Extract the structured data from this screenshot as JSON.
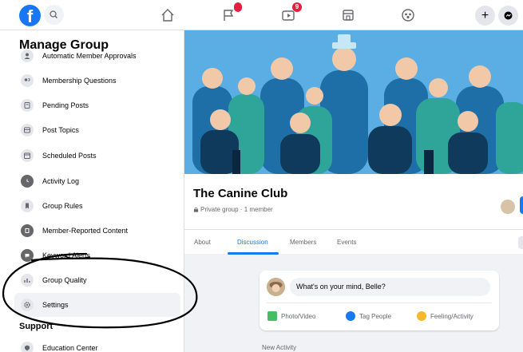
{
  "topbar": {
    "logo": "f",
    "notifications_badge": "",
    "video_badge": "9",
    "plus": "+"
  },
  "sidebar": {
    "title": "Manage Group",
    "items": [
      {
        "label": "Automatic Member Approvals",
        "icon": "member-approvals-icon"
      },
      {
        "label": "Membership Questions",
        "icon": "question-icon"
      },
      {
        "label": "Pending Posts",
        "icon": "pending-posts-icon"
      },
      {
        "label": "Post Topics",
        "icon": "post-topics-icon"
      },
      {
        "label": "Scheduled Posts",
        "icon": "calendar-icon"
      },
      {
        "label": "Activity Log",
        "icon": "clock-icon"
      },
      {
        "label": "Group Rules",
        "icon": "rules-icon"
      },
      {
        "label": "Member-Reported Content",
        "icon": "report-icon"
      },
      {
        "label": "Keyword Alerts",
        "icon": "keyword-icon"
      },
      {
        "label": "Group Quality",
        "icon": "quality-icon"
      },
      {
        "label": "Settings",
        "icon": "gear-icon"
      }
    ],
    "support_title": "Support",
    "support_items": [
      {
        "label": "Education Center",
        "icon": "education-icon"
      }
    ]
  },
  "group": {
    "name": "The Canine Club",
    "meta": "Private group · 1 member",
    "tabs": [
      "About",
      "Discussion",
      "Members",
      "Events"
    ],
    "active_tab": "Discussion"
  },
  "composer": {
    "placeholder": "What's on your mind, Belle?",
    "actions": [
      "Photo/Video",
      "Tag People",
      "Feeling/Activity"
    ]
  },
  "feed": {
    "section": "New Activity"
  },
  "colors": {
    "brand": "#1877f2",
    "badge": "#e41e3f",
    "cover": "#64b3e6"
  }
}
